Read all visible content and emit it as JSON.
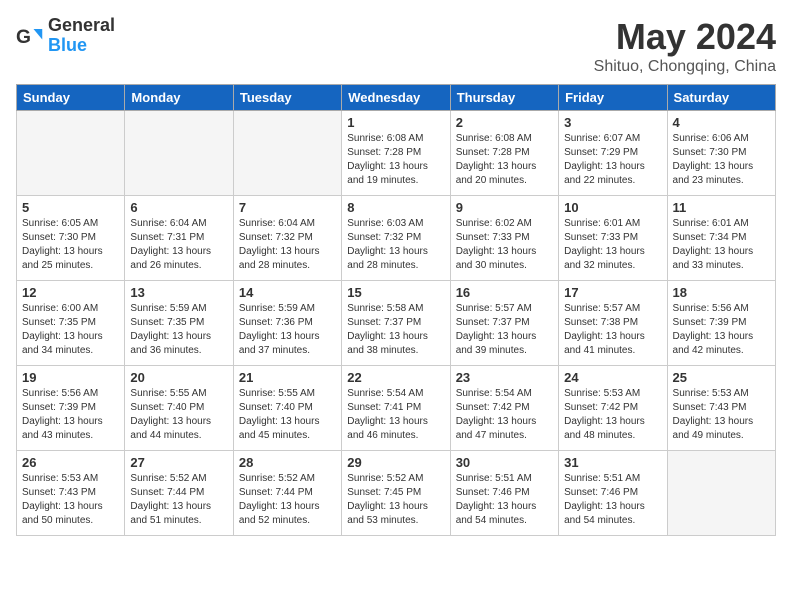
{
  "header": {
    "logo_general": "General",
    "logo_blue": "Blue",
    "title": "May 2024",
    "location": "Shituo, Chongqing, China"
  },
  "weekdays": [
    "Sunday",
    "Monday",
    "Tuesday",
    "Wednesday",
    "Thursday",
    "Friday",
    "Saturday"
  ],
  "weeks": [
    [
      {
        "day": "",
        "empty": true
      },
      {
        "day": "",
        "empty": true
      },
      {
        "day": "",
        "empty": true
      },
      {
        "day": "1",
        "sunrise": "6:08 AM",
        "sunset": "7:28 PM",
        "daylight": "13 hours and 19 minutes."
      },
      {
        "day": "2",
        "sunrise": "6:08 AM",
        "sunset": "7:28 PM",
        "daylight": "13 hours and 20 minutes."
      },
      {
        "day": "3",
        "sunrise": "6:07 AM",
        "sunset": "7:29 PM",
        "daylight": "13 hours and 22 minutes."
      },
      {
        "day": "4",
        "sunrise": "6:06 AM",
        "sunset": "7:30 PM",
        "daylight": "13 hours and 23 minutes."
      }
    ],
    [
      {
        "day": "5",
        "sunrise": "6:05 AM",
        "sunset": "7:30 PM",
        "daylight": "13 hours and 25 minutes."
      },
      {
        "day": "6",
        "sunrise": "6:04 AM",
        "sunset": "7:31 PM",
        "daylight": "13 hours and 26 minutes."
      },
      {
        "day": "7",
        "sunrise": "6:04 AM",
        "sunset": "7:32 PM",
        "daylight": "13 hours and 28 minutes."
      },
      {
        "day": "8",
        "sunrise": "6:03 AM",
        "sunset": "7:32 PM",
        "daylight": "13 hours and 28 minutes."
      },
      {
        "day": "9",
        "sunrise": "6:02 AM",
        "sunset": "7:33 PM",
        "daylight": "13 hours and 30 minutes."
      },
      {
        "day": "10",
        "sunrise": "6:01 AM",
        "sunset": "7:33 PM",
        "daylight": "13 hours and 32 minutes."
      },
      {
        "day": "11",
        "sunrise": "6:01 AM",
        "sunset": "7:34 PM",
        "daylight": "13 hours and 33 minutes."
      }
    ],
    [
      {
        "day": "12",
        "sunrise": "6:00 AM",
        "sunset": "7:35 PM",
        "daylight": "13 hours and 34 minutes."
      },
      {
        "day": "13",
        "sunrise": "5:59 AM",
        "sunset": "7:35 PM",
        "daylight": "13 hours and 36 minutes."
      },
      {
        "day": "14",
        "sunrise": "5:59 AM",
        "sunset": "7:36 PM",
        "daylight": "13 hours and 37 minutes."
      },
      {
        "day": "15",
        "sunrise": "5:58 AM",
        "sunset": "7:37 PM",
        "daylight": "13 hours and 38 minutes."
      },
      {
        "day": "16",
        "sunrise": "5:57 AM",
        "sunset": "7:37 PM",
        "daylight": "13 hours and 39 minutes."
      },
      {
        "day": "17",
        "sunrise": "5:57 AM",
        "sunset": "7:38 PM",
        "daylight": "13 hours and 41 minutes."
      },
      {
        "day": "18",
        "sunrise": "5:56 AM",
        "sunset": "7:39 PM",
        "daylight": "13 hours and 42 minutes."
      }
    ],
    [
      {
        "day": "19",
        "sunrise": "5:56 AM",
        "sunset": "7:39 PM",
        "daylight": "13 hours and 43 minutes."
      },
      {
        "day": "20",
        "sunrise": "5:55 AM",
        "sunset": "7:40 PM",
        "daylight": "13 hours and 44 minutes."
      },
      {
        "day": "21",
        "sunrise": "5:55 AM",
        "sunset": "7:40 PM",
        "daylight": "13 hours and 45 minutes."
      },
      {
        "day": "22",
        "sunrise": "5:54 AM",
        "sunset": "7:41 PM",
        "daylight": "13 hours and 46 minutes."
      },
      {
        "day": "23",
        "sunrise": "5:54 AM",
        "sunset": "7:42 PM",
        "daylight": "13 hours and 47 minutes."
      },
      {
        "day": "24",
        "sunrise": "5:53 AM",
        "sunset": "7:42 PM",
        "daylight": "13 hours and 48 minutes."
      },
      {
        "day": "25",
        "sunrise": "5:53 AM",
        "sunset": "7:43 PM",
        "daylight": "13 hours and 49 minutes."
      }
    ],
    [
      {
        "day": "26",
        "sunrise": "5:53 AM",
        "sunset": "7:43 PM",
        "daylight": "13 hours and 50 minutes."
      },
      {
        "day": "27",
        "sunrise": "5:52 AM",
        "sunset": "7:44 PM",
        "daylight": "13 hours and 51 minutes."
      },
      {
        "day": "28",
        "sunrise": "5:52 AM",
        "sunset": "7:44 PM",
        "daylight": "13 hours and 52 minutes."
      },
      {
        "day": "29",
        "sunrise": "5:52 AM",
        "sunset": "7:45 PM",
        "daylight": "13 hours and 53 minutes."
      },
      {
        "day": "30",
        "sunrise": "5:51 AM",
        "sunset": "7:46 PM",
        "daylight": "13 hours and 54 minutes."
      },
      {
        "day": "31",
        "sunrise": "5:51 AM",
        "sunset": "7:46 PM",
        "daylight": "13 hours and 54 minutes."
      },
      {
        "day": "",
        "empty": true
      }
    ]
  ]
}
